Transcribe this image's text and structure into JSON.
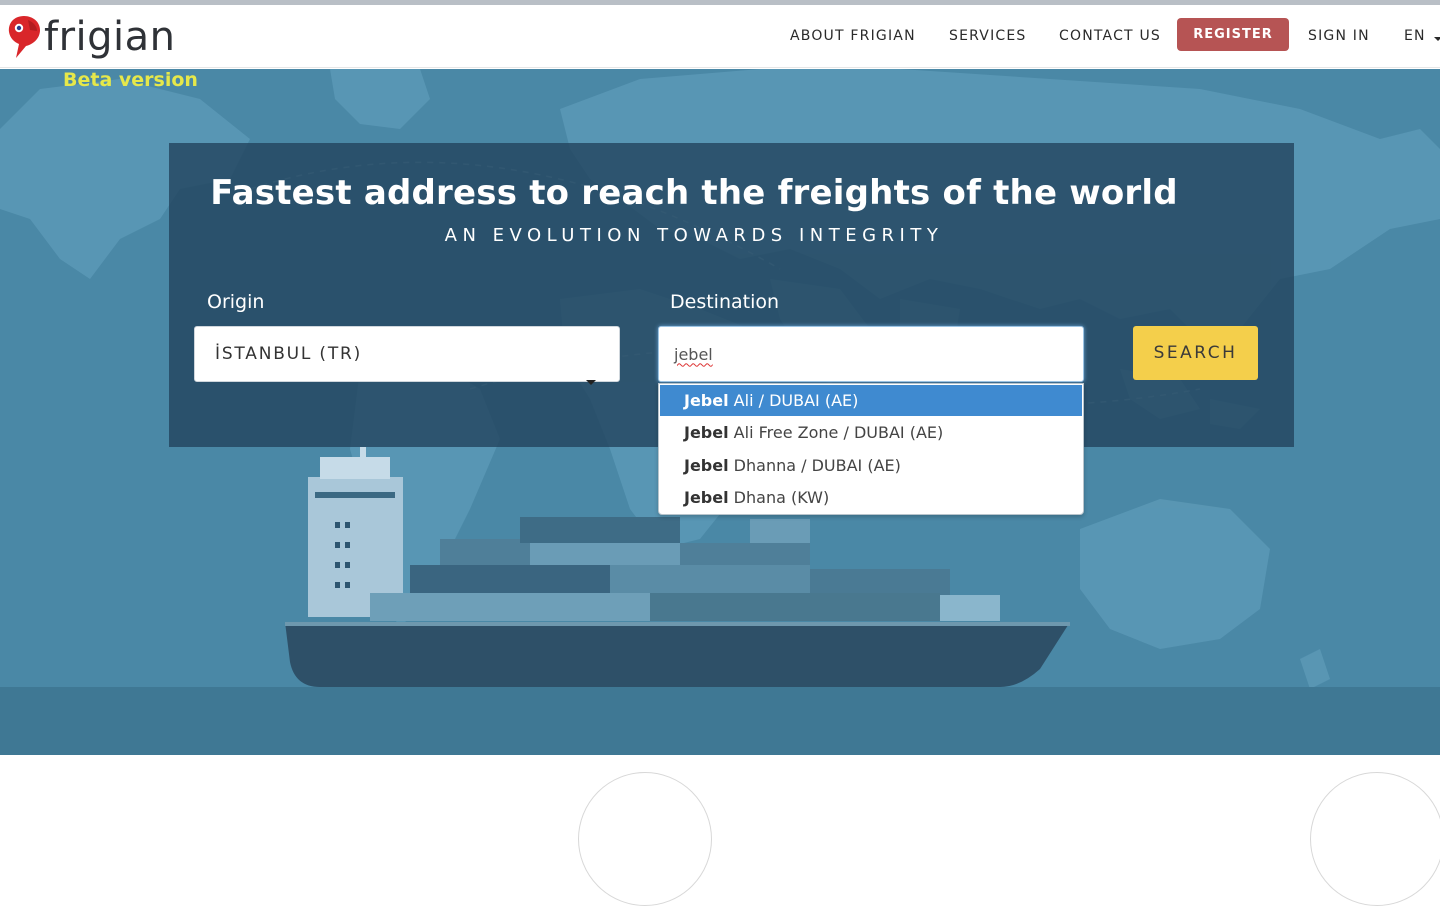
{
  "brand": {
    "name": "frigian",
    "beta_label": "Beta version"
  },
  "nav": {
    "about": "ABOUT FRIGIAN",
    "services": "SERVICES",
    "contact": "CONTACT US",
    "register": "REGISTER",
    "sign_in": "SIGN IN",
    "language": "EN"
  },
  "hero": {
    "headline": "Fastest address to reach the freights of the world",
    "subline": "AN EVOLUTION TOWARDS INTEGRITY"
  },
  "search": {
    "origin_label": "Origin",
    "origin_value": "İSTANBUL (TR)",
    "destination_label": "Destination",
    "destination_value": "jebel",
    "button_label": "SEARCH",
    "suggestions": [
      {
        "match": "Jebel",
        "rest": " Ali / DUBAI (AE)",
        "active": true
      },
      {
        "match": "Jebel",
        "rest": " Ali Free Zone / DUBAI (AE)",
        "active": false
      },
      {
        "match": "Jebel",
        "rest": " Dhanna / DUBAI (AE)",
        "active": false
      },
      {
        "match": "Jebel",
        "rest": " Dhana (KW)",
        "active": false
      }
    ]
  },
  "colors": {
    "hero_bg": "#4a88a6",
    "register_bg": "#b65454",
    "search_bg": "#f4cf4b",
    "beta": "#e6e84a",
    "dropdown_active": "#3f8ad0"
  }
}
